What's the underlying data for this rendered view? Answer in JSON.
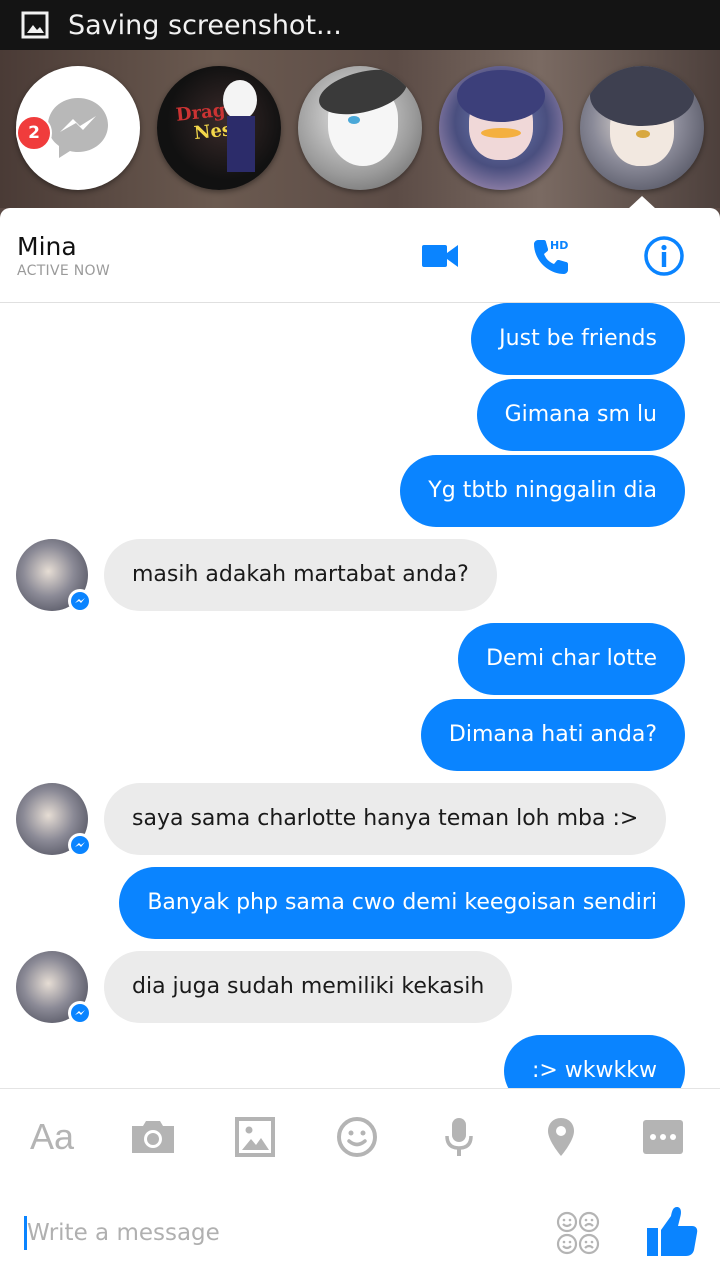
{
  "status_bar": {
    "text": "Saving screenshot...",
    "icon": "gallery-icon"
  },
  "chat_heads": {
    "badge_count": "2",
    "items": [
      {
        "name": "messenger",
        "icon": "messenger-icon"
      },
      {
        "name": "dragon-nest-avatar",
        "art_line1": "Dragon",
        "art_line2": "Nest"
      },
      {
        "name": "anime-avatar-gray"
      },
      {
        "name": "anime-avatar-purple"
      },
      {
        "name": "mina-avatar"
      }
    ]
  },
  "header": {
    "name": "Mina",
    "status": "ACTIVE NOW",
    "call_badge": "HD"
  },
  "messages": [
    {
      "dir": "out",
      "text": "Just be friends"
    },
    {
      "dir": "out",
      "text": "Gimana sm lu"
    },
    {
      "dir": "out",
      "text": "Yg tbtb ninggalin dia"
    },
    {
      "dir": "in",
      "text": "masih adakah martabat anda?"
    },
    {
      "dir": "out",
      "text": "Demi char lotte"
    },
    {
      "dir": "out",
      "text": "Dimana hati anda?"
    },
    {
      "dir": "in",
      "text": "saya sama charlotte hanya teman loh mba :>"
    },
    {
      "dir": "out",
      "text": "Banyak php sama cwo demi keegoisan sendiri"
    },
    {
      "dir": "in",
      "text": "dia juga sudah memiliki kekasih"
    },
    {
      "dir": "out",
      "text": ":> wkwkkw"
    }
  ],
  "toolbar": {
    "text_format_label": "Aa",
    "icons": [
      "camera-icon",
      "image-icon",
      "emoji-icon",
      "microphone-icon",
      "location-icon",
      "more-icon"
    ]
  },
  "composer": {
    "placeholder": "Write a message",
    "value": ""
  },
  "colors": {
    "accent": "#0a84ff",
    "incoming_bubble": "#ebebeb",
    "badge": "#f03c3c",
    "toolbar_icon": "#b4b4b4"
  }
}
